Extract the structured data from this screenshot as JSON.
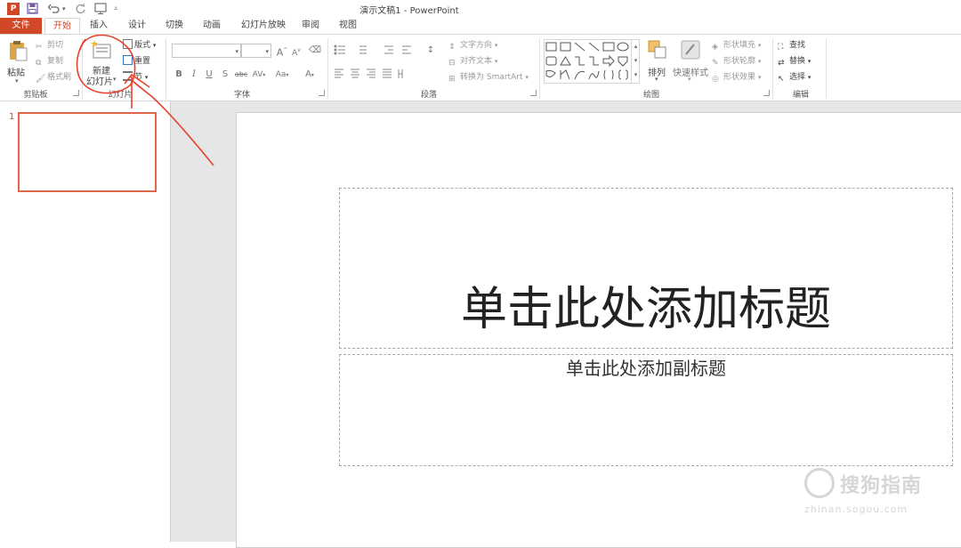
{
  "window": {
    "title": "演示文稿1 - PowerPoint"
  },
  "colors": {
    "accent": "#d24726",
    "annotation": "#e8412c"
  },
  "quick_access": [
    "powerpoint-logo-icon",
    "save-icon",
    "undo-icon",
    "redo-icon",
    "start-from-beginning-icon",
    "customize-qat-icon"
  ],
  "tabs": [
    {
      "label": "文件"
    },
    {
      "label": "开始"
    },
    {
      "label": "插入"
    },
    {
      "label": "设计"
    },
    {
      "label": "切换"
    },
    {
      "label": "动画"
    },
    {
      "label": "幻灯片放映"
    },
    {
      "label": "审阅"
    },
    {
      "label": "视图"
    }
  ],
  "ribbon": {
    "clipboard": {
      "label": "剪贴板",
      "paste": "粘贴",
      "cut": "剪切",
      "copy": "复制",
      "format_painter": "格式刷"
    },
    "slides": {
      "label": "幻灯片",
      "new_slide_line1": "新建",
      "new_slide_line2": "幻灯片",
      "layout": "版式",
      "reset": "重置",
      "section": "节"
    },
    "font": {
      "label": "字体",
      "bold": "B",
      "italic": "I",
      "underline": "U",
      "shadow": "S",
      "strike": "abc",
      "spacing": "AV",
      "case": "Aa",
      "color": "A",
      "grow": "A",
      "shrink": "A"
    },
    "paragraph": {
      "label": "段落",
      "text_direction": "文字方向",
      "align_text": "对齐文本",
      "smartart": "转换为 SmartArt"
    },
    "drawing": {
      "label": "绘图",
      "arrange": "排列",
      "quick_styles": "快速样式",
      "shape_fill": "形状填充",
      "shape_outline": "形状轮廓",
      "shape_effects": "形状效果"
    },
    "editing": {
      "label": "编辑",
      "find": "查找",
      "replace": "替换",
      "select": "选择"
    }
  },
  "thumbnails": {
    "number": "1"
  },
  "slide": {
    "title_placeholder": "单击此处添加标题",
    "subtitle_placeholder": "单击此处添加副标题"
  },
  "watermark": {
    "main": "搜狗指南",
    "sub": "zhinan.sogou.com"
  }
}
